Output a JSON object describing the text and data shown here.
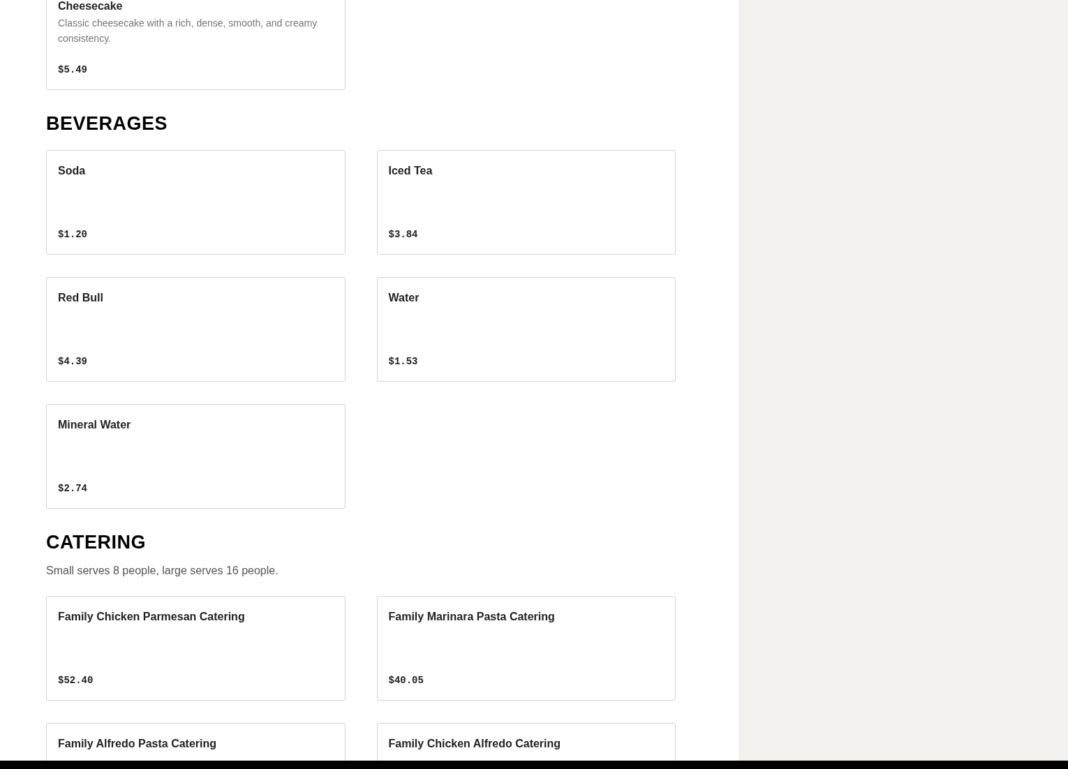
{
  "sections": [
    {
      "items": [
        {
          "name": "Cheesecake",
          "description": "Classic cheesecake with a rich, dense, smooth, and creamy consistency.",
          "price": "$5.49"
        }
      ]
    },
    {
      "title": "BEVERAGES",
      "items": [
        {
          "name": "Soda",
          "price": "$1.20"
        },
        {
          "name": "Iced Tea",
          "price": "$3.84"
        },
        {
          "name": "Red Bull",
          "price": "$4.39"
        },
        {
          "name": "Water",
          "price": "$1.53"
        },
        {
          "name": "Mineral Water",
          "price": "$2.74"
        }
      ]
    },
    {
      "title": "CATERING",
      "subtitle": "Small serves 8 people, large serves 16 people.",
      "items": [
        {
          "name": "Family Chicken Parmesan Catering",
          "price": "$52.40"
        },
        {
          "name": "Family Marinara Pasta Catering",
          "price": "$40.05"
        },
        {
          "name": "Family Alfredo Pasta Catering"
        },
        {
          "name": "Family Chicken Alfredo Catering"
        }
      ]
    }
  ]
}
